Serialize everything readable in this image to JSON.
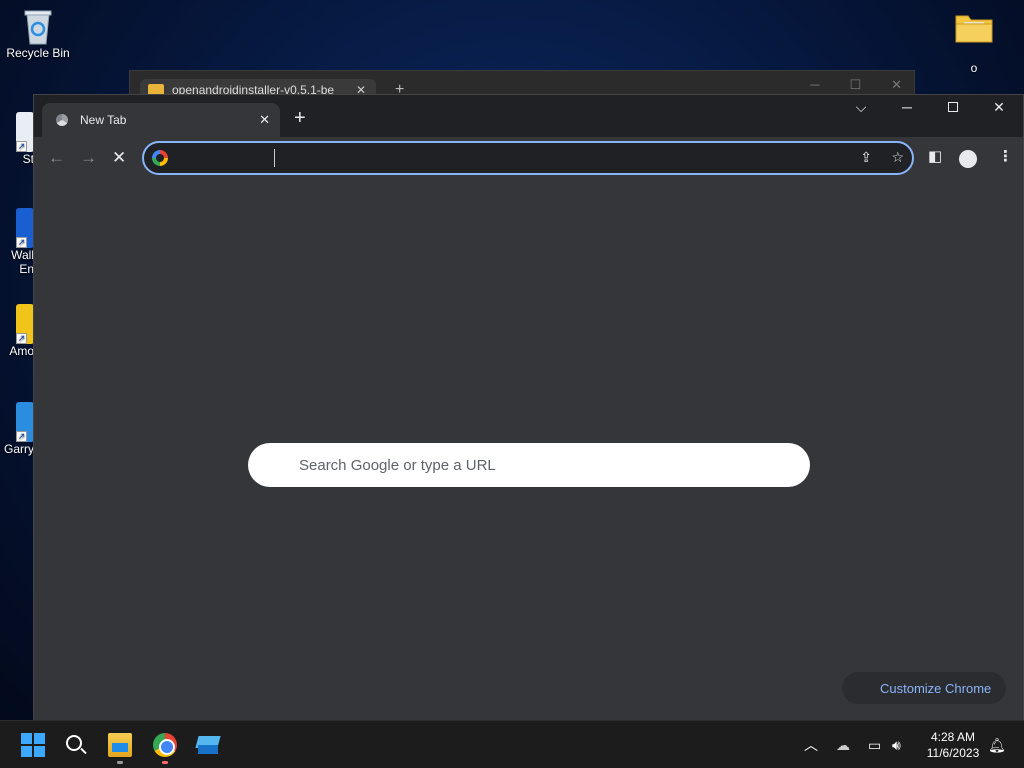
{
  "desktop": {
    "icons": [
      {
        "label": "Recycle Bin"
      },
      {
        "label": "o"
      }
    ],
    "partial_labels": [
      "St",
      "Wall",
      "En",
      "Amo",
      "Garry"
    ]
  },
  "background_window": {
    "tab_title": "openandroidinstaller-v0.5.1-be"
  },
  "chrome": {
    "tab_title": "New Tab",
    "omnibox_value": "",
    "ntp_search_placeholder": "Search Google or type a URL",
    "customize_label": "Customize Chrome"
  },
  "taskbar": {
    "time": "4:28 AM",
    "date": "11/6/2023"
  },
  "colors": {
    "accent": "#8ab4f8",
    "chrome_bg": "#35363a",
    "taskbar_bg": "#1c1c1c"
  }
}
